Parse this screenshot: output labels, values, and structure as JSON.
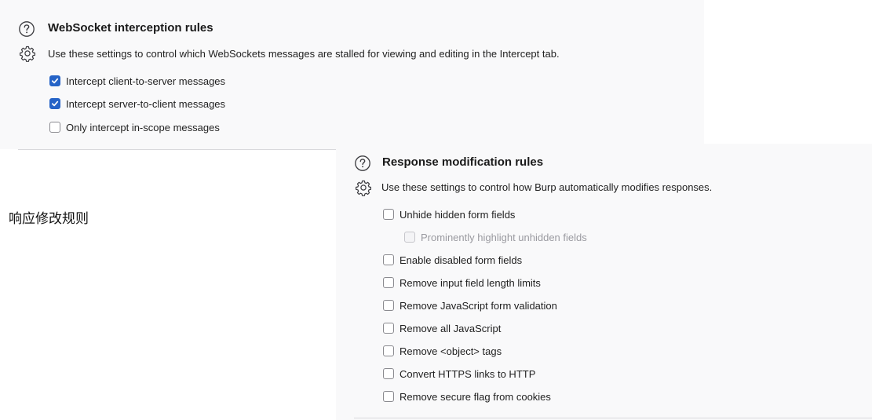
{
  "websocket_section": {
    "title": "WebSocket interception rules",
    "description": "Use these settings to control which WebSockets messages are stalled for viewing and editing in the Intercept tab.",
    "options": [
      {
        "label": "Intercept client-to-server messages",
        "checked": true,
        "enabled": true
      },
      {
        "label": "Intercept server-to-client messages",
        "checked": true,
        "enabled": true
      },
      {
        "label": "Only intercept in-scope messages",
        "checked": false,
        "enabled": true
      }
    ]
  },
  "response_section": {
    "title": "Response modification rules",
    "description": "Use these settings to control how Burp automatically modifies responses.",
    "options": [
      {
        "label": "Unhide hidden form fields",
        "checked": false,
        "enabled": true
      },
      {
        "label": "Prominently highlight unhidden fields",
        "checked": false,
        "enabled": false
      },
      {
        "label": "Enable disabled form fields",
        "checked": false,
        "enabled": true
      },
      {
        "label": "Remove input field length limits",
        "checked": false,
        "enabled": true
      },
      {
        "label": "Remove JavaScript form validation",
        "checked": false,
        "enabled": true
      },
      {
        "label": "Remove all JavaScript",
        "checked": false,
        "enabled": true
      },
      {
        "label": "Remove <object> tags",
        "checked": false,
        "enabled": true
      },
      {
        "label": "Convert HTTPS links to HTTP",
        "checked": false,
        "enabled": true
      },
      {
        "label": "Remove secure flag from cookies",
        "checked": false,
        "enabled": true
      }
    ]
  },
  "annotation": {
    "text": "响应修改规则"
  },
  "colors": {
    "checkbox_checked": "#2563c7",
    "panel_background": "#f9f9fa"
  },
  "icons": {
    "help": "help-icon",
    "settings": "gear-icon"
  }
}
